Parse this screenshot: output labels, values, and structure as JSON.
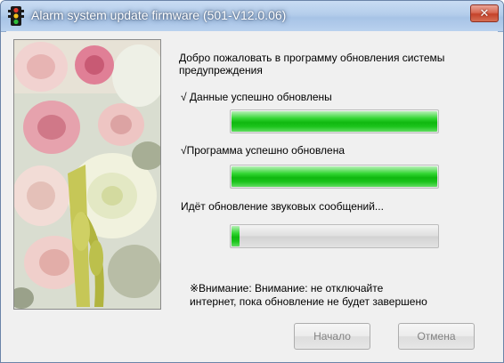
{
  "window": {
    "title": "Alarm system update firmware (501-V12.0.06)",
    "close_symbol": "✕",
    "icon": "traffic-light-icon"
  },
  "content": {
    "welcome": "Добро пожаловать в программу обновления системы предупреждения",
    "step1_label": "√ Данные успешно обновлены",
    "step1_progress": 1.0,
    "step2_label": "√Программа успешно обновлена",
    "step2_progress": 1.0,
    "step3_label": "Идёт обновление звуковых сообщений...",
    "step3_progress": 0.04,
    "notice_line1": "※Внимание: Внимание: не отключайте",
    "notice_line2": "интернет, пока обновление не будет завершено"
  },
  "buttons": {
    "start_label": "Начало",
    "cancel_label": "Отмена",
    "enabled": false
  },
  "colors": {
    "progress_green": "#10b810",
    "title_bar": "#b4cdeb",
    "close_button": "#c5422a"
  }
}
